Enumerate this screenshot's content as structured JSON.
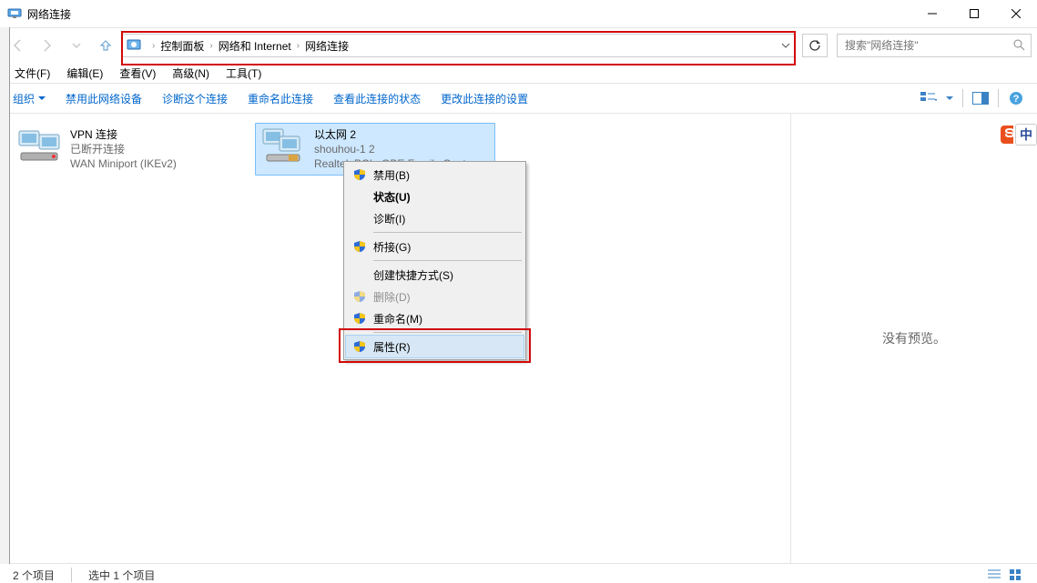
{
  "window": {
    "title": "网络连接"
  },
  "breadcrumb": {
    "items": [
      "控制面板",
      "网络和 Internet",
      "网络连接"
    ]
  },
  "search": {
    "placeholder": "搜索\"网络连接\""
  },
  "menubar": {
    "file": "文件(F)",
    "edit": "编辑(E)",
    "view": "查看(V)",
    "advanced": "高级(N)",
    "tools": "工具(T)"
  },
  "cmdbar": {
    "organize": "组织",
    "disable": "禁用此网络设备",
    "diagnose": "诊断这个连接",
    "rename": "重命名此连接",
    "status": "查看此连接的状态",
    "change": "更改此连接的设置"
  },
  "connections": [
    {
      "name": "VPN 连接",
      "status": "已断开连接",
      "device": "WAN Miniport (IKEv2)",
      "selected": false,
      "type": "vpn"
    },
    {
      "name": "以太网 2",
      "status": "shouhou-1  2",
      "device": "Realtek PCIe GBE Family Contr...",
      "selected": true,
      "type": "ethernet"
    }
  ],
  "contextmenu": {
    "disable": "禁用(B)",
    "state": "状态(U)",
    "diagnose": "诊断(I)",
    "bridge": "桥接(G)",
    "shortcut": "创建快捷方式(S)",
    "delete": "删除(D)",
    "rename": "重命名(M)",
    "props": "属性(R)"
  },
  "preview": {
    "none": "没有预览。"
  },
  "statusbar": {
    "count": "2 个项目",
    "selected": "选中 1 个项目"
  },
  "ime": {
    "label": "中"
  }
}
